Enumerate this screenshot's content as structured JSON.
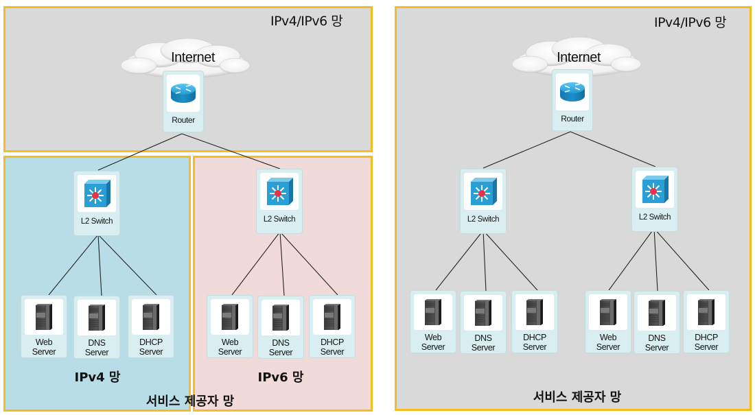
{
  "left_diagram": {
    "top_zone": {
      "title": "IPv4/IPv6 망"
    },
    "internet": {
      "label": "Internet"
    },
    "router": {
      "label": "Router"
    },
    "ipv4_zone": {
      "caption": "IPv4 망",
      "switch": {
        "label": "L2 Switch"
      },
      "servers": [
        {
          "line1": "Web",
          "line2": "Server"
        },
        {
          "line1": "DNS",
          "line2": "Server"
        },
        {
          "line1": "DHCP",
          "line2": "Server"
        }
      ]
    },
    "ipv6_zone": {
      "caption": "IPv6 망",
      "switch": {
        "label": "L2 Switch"
      },
      "servers": [
        {
          "line1": "Web",
          "line2": "Server"
        },
        {
          "line1": "DNS",
          "line2": "Server"
        },
        {
          "line1": "DHCP",
          "line2": "Server"
        }
      ]
    },
    "bottom_caption": "서비스 제공자 망"
  },
  "right_diagram": {
    "zone_title": "IPv4/IPv6 망",
    "internet": {
      "label": "Internet"
    },
    "router": {
      "label": "Router"
    },
    "left_switch": {
      "label": "L2 Switch",
      "servers": [
        {
          "line1": "Web",
          "line2": "Server"
        },
        {
          "line1": "DNS",
          "line2": "Server"
        },
        {
          "line1": "DHCP",
          "line2": "Server"
        }
      ]
    },
    "right_switch": {
      "label": "L2 Switch",
      "servers": [
        {
          "line1": "Web",
          "line2": "Server"
        },
        {
          "line1": "DNS",
          "line2": "Server"
        },
        {
          "line1": "DHCP",
          "line2": "Server"
        }
      ]
    },
    "bottom_caption": "서비스 제공자 망"
  },
  "colors": {
    "zone_border": "#f5bd1f",
    "zone_gray": "#d9d9d9",
    "zone_ipv4": "#b8dde7",
    "zone_ipv6": "#f0dada",
    "node_bg": "#d9eef0",
    "router_blue": "#1e9fd8",
    "switch_blue": "#2a9fd6",
    "switch_center": "#e8334a"
  }
}
